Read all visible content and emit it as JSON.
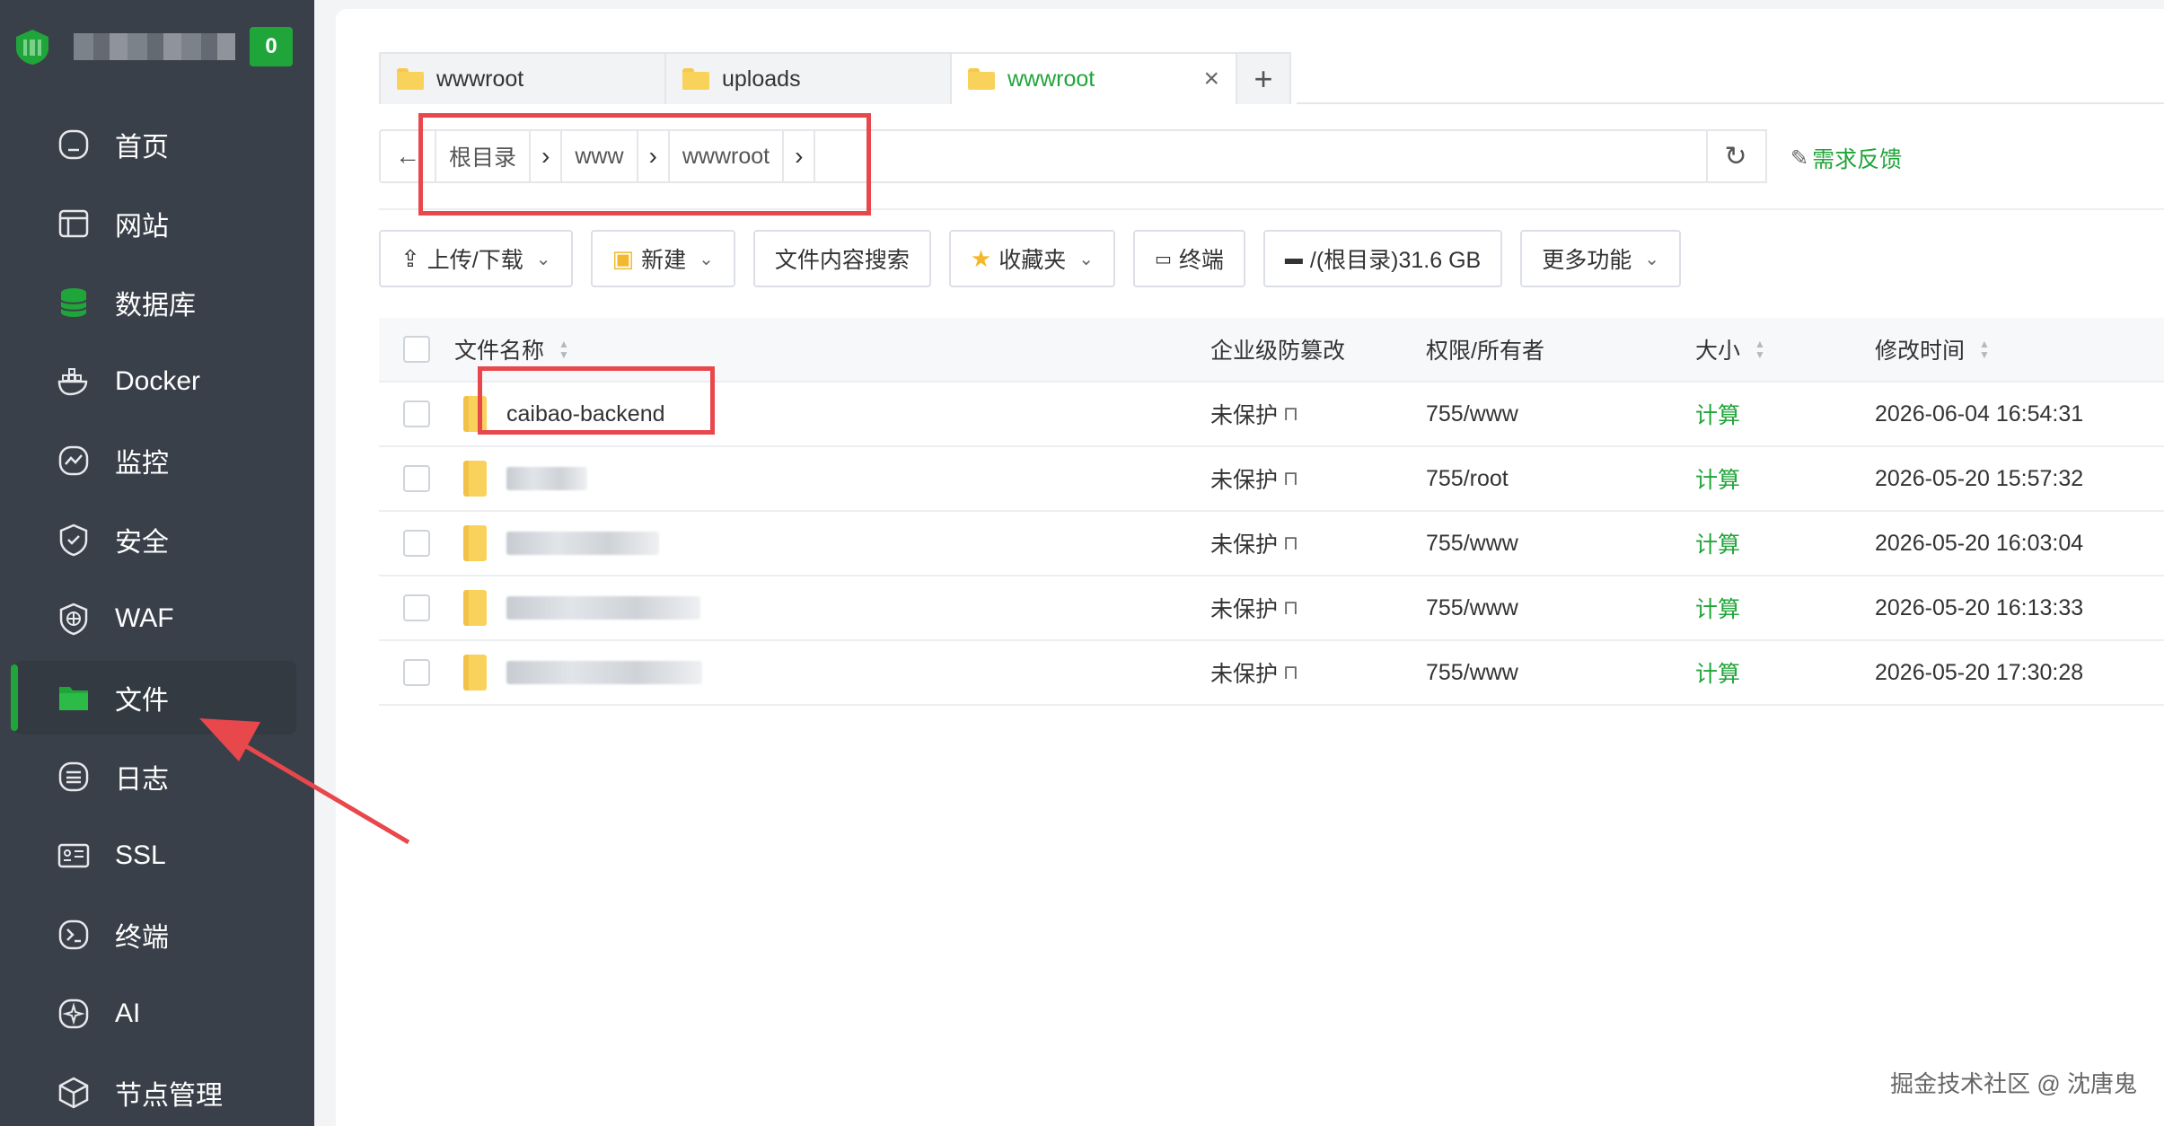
{
  "brand": {
    "badge": "0"
  },
  "sidebar": {
    "items": [
      {
        "label": "首页",
        "icon": "home-icon"
      },
      {
        "label": "网站",
        "icon": "website-icon"
      },
      {
        "label": "数据库",
        "icon": "database-icon"
      },
      {
        "label": "Docker",
        "icon": "docker-icon"
      },
      {
        "label": "监控",
        "icon": "monitor-icon"
      },
      {
        "label": "安全",
        "icon": "shield-icon"
      },
      {
        "label": "WAF",
        "icon": "waf-icon"
      },
      {
        "label": "文件",
        "icon": "folder-icon"
      },
      {
        "label": "日志",
        "icon": "log-icon"
      },
      {
        "label": "SSL",
        "icon": "ssl-icon"
      },
      {
        "label": "终端",
        "icon": "terminal-icon"
      },
      {
        "label": "AI",
        "icon": "ai-icon"
      },
      {
        "label": "节点管理",
        "icon": "node-icon"
      }
    ]
  },
  "tabs": [
    {
      "label": "wwwroot"
    },
    {
      "label": "uploads"
    },
    {
      "label": "wwwroot"
    }
  ],
  "path": {
    "crumbs": [
      "根目录",
      "www",
      "wwwroot"
    ],
    "feedback": "需求反馈"
  },
  "toolbar": {
    "upload": "上传/下载",
    "new": "新建",
    "search": "文件内容搜索",
    "favorites": "收藏夹",
    "terminal": "终端",
    "disk": "/(根目录)31.6 GB",
    "more": "更多功能"
  },
  "table": {
    "headers": {
      "name": "文件名称",
      "protect": "企业级防篡改",
      "perm": "权限/所有者",
      "size": "大小",
      "time": "修改时间"
    },
    "rows": [
      {
        "name": "caibao-backend",
        "protect": "未保护",
        "perm": "755/www",
        "size": "计算",
        "time": "2026-06-04 16:54:31"
      },
      {
        "name": "",
        "protect": "未保护",
        "perm": "755/root",
        "size": "计算",
        "time": "2026-05-20 15:57:32"
      },
      {
        "name": "",
        "protect": "未保护",
        "perm": "755/www",
        "size": "计算",
        "time": "2026-05-20 16:03:04"
      },
      {
        "name": "",
        "protect": "未保护",
        "perm": "755/www",
        "size": "计算",
        "time": "2026-05-20 16:13:33"
      },
      {
        "name": "",
        "protect": "未保护",
        "perm": "755/www",
        "size": "计算",
        "time": "2026-05-20 17:30:28"
      }
    ]
  },
  "watermark": "掘金技术社区 @ 沈唐鬼",
  "colors": {
    "accent": "#20a53a",
    "annotation": "#e8474c",
    "sidebar": "#3a4049"
  }
}
